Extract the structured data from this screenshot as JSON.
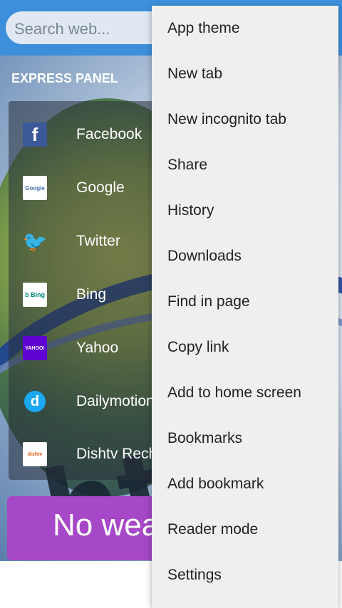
{
  "search": {
    "placeholder": "Search web..."
  },
  "express_panel": {
    "title": "EXPRESS PANEL"
  },
  "panel_items": [
    {
      "label": "Facebook",
      "icon": "facebook-icon",
      "icon_text": "f"
    },
    {
      "label": "Google",
      "icon": "google-icon",
      "icon_text": "Google"
    },
    {
      "label": "Twitter",
      "icon": "twitter-icon",
      "icon_text": "🐦"
    },
    {
      "label": "Bing",
      "icon": "bing-icon",
      "icon_text": "b Bing"
    },
    {
      "label": "Yahoo",
      "icon": "yahoo-icon",
      "icon_text": "YAHOO!"
    },
    {
      "label": "Dailymotion",
      "icon": "dailymotion-icon",
      "icon_text": "d"
    },
    {
      "label": "Dishtv Rech",
      "icon": "dishtv-icon",
      "icon_text": "dishtv"
    }
  ],
  "weather": {
    "text": "No wea"
  },
  "menu": {
    "items": [
      "App theme",
      "New tab",
      "New incognito tab",
      "Share",
      "History",
      "Downloads",
      "Find in page",
      "Copy link",
      "Add to home screen",
      "Bookmarks",
      "Add bookmark",
      "Reader mode",
      "Settings"
    ]
  },
  "colors": {
    "topbar": "#3d8fdc",
    "menu_bg": "#efefef",
    "weather_bg": "#a648c7"
  }
}
